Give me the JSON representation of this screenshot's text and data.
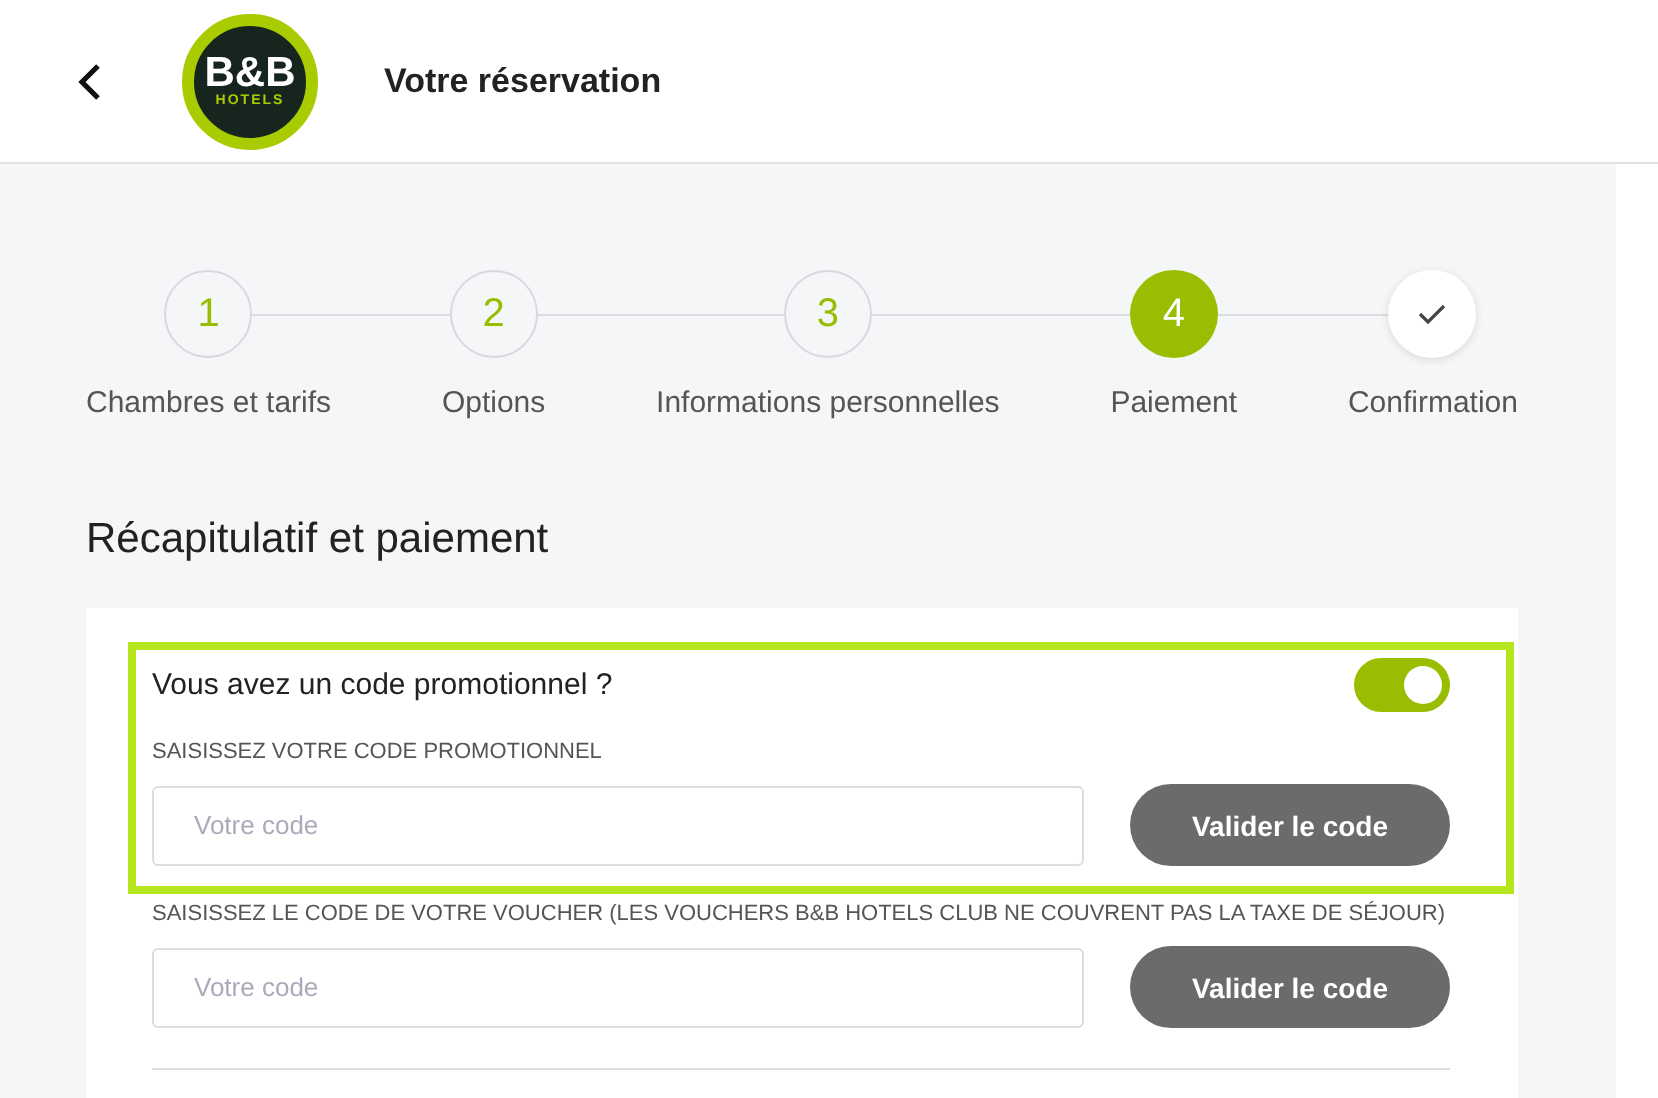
{
  "header": {
    "title": "Votre réservation",
    "logo_text": "B&B",
    "logo_subtext": "HOTELS"
  },
  "steps": [
    {
      "marker": "1",
      "label": "Chambres et tarifs",
      "kind": "done"
    },
    {
      "marker": "2",
      "label": "Options",
      "kind": "done"
    },
    {
      "marker": "3",
      "label": "Informations personnelles",
      "kind": "done"
    },
    {
      "marker": "4",
      "label": "Paiement",
      "kind": "current"
    },
    {
      "label": "Confirmation",
      "kind": "pending"
    }
  ],
  "section_title": "Récapitulatif et paiement",
  "promo": {
    "question": "Vous avez un code promotionnel ?",
    "on": true,
    "highlighted": true,
    "fields": [
      {
        "label": "SAISISSEZ VOTRE CODE PROMOTIONNEL",
        "placeholder": "Votre code",
        "button": "Valider le code"
      }
    ]
  },
  "voucher": {
    "fields": [
      {
        "label": "SAISISSEZ LE CODE DE VOTRE VOUCHER (LES VOUCHERS B&B HOTELS CLUB NE COUVRENT PAS LA TAXE DE SÉJOUR)",
        "placeholder": "Votre code",
        "button": "Valider le code"
      }
    ]
  }
}
